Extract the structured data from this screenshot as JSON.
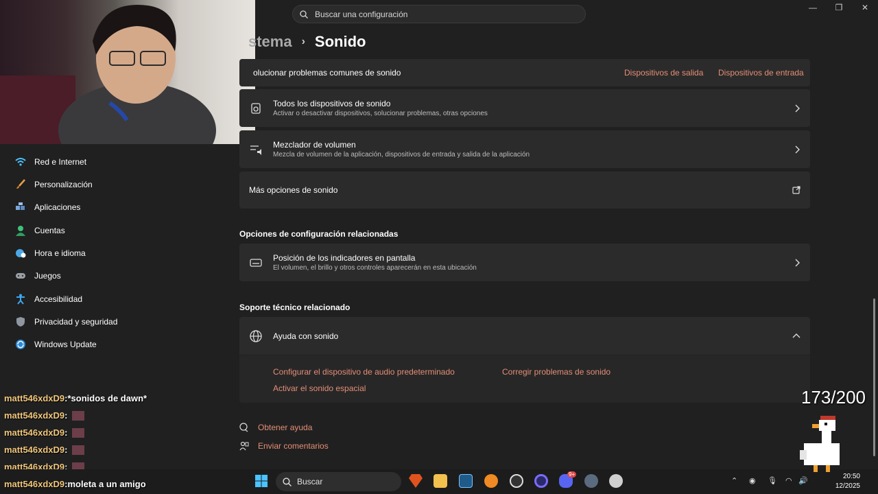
{
  "window": {
    "search_placeholder": "Buscar una configuración",
    "controls": [
      "minimize-icon",
      "restore-icon",
      "close-icon"
    ]
  },
  "breadcrumb": {
    "parent": "stema",
    "current": "Sonido"
  },
  "troubleshoot": {
    "label": "olucionar problemas comunes de sonido",
    "link_output": "Dispositivos de salida",
    "link_input": "Dispositivos de entrada"
  },
  "cards": {
    "all_devices": {
      "title": "Todos los dispositivos de sonido",
      "desc": "Activar o desactivar dispositivos, solucionar problemas, otras opciones"
    },
    "mixer": {
      "title": "Mezclador de volumen",
      "desc": "Mezcla de volumen de la aplicación, dispositivos de entrada y salida de la aplicación"
    },
    "more": {
      "title": "Más opciones de sonido"
    }
  },
  "related_settings": {
    "heading": "Opciones de configuración relacionadas",
    "indicator": {
      "title": "Posición de los indicadores en pantalla",
      "desc": "El volumen, el brillo y otros controles aparecerán en esta ubicación"
    }
  },
  "support": {
    "heading": "Soporte técnico relacionado",
    "help_title": "Ayuda con sonido",
    "links": {
      "default_device": "Configurar el dispositivo de audio predeterminado",
      "fix": "Corregir problemas de sonido",
      "spatial": "Activar el sonido espacial"
    }
  },
  "footer": {
    "get_help": "Obtener ayuda",
    "feedback": "Enviar comentarios"
  },
  "sidebar": {
    "items": [
      {
        "label": "Red e Internet",
        "icon": "wifi-icon",
        "color": "#4cc2ff"
      },
      {
        "label": "Personalización",
        "icon": "brush-icon",
        "color": "#e8a04a"
      },
      {
        "label": "Aplicaciones",
        "icon": "apps-icon",
        "color": "#7aa7d9"
      },
      {
        "label": "Cuentas",
        "icon": "person-icon",
        "color": "#3fc27a"
      },
      {
        "label": "Hora e idioma",
        "icon": "globe-clock-icon",
        "color": "#4aa8e8"
      },
      {
        "label": "Juegos",
        "icon": "gamepad-icon",
        "color": "#9aa0a6"
      },
      {
        "label": "Accesibilidad",
        "icon": "accessibility-icon",
        "color": "#3ea6f0"
      },
      {
        "label": "Privacidad y seguridad",
        "icon": "shield-icon",
        "color": "#8f96a0"
      },
      {
        "label": "Windows Update",
        "icon": "update-icon",
        "color": "#2d8ad6"
      }
    ]
  },
  "chat": {
    "messages": [
      {
        "user": "matt546xdxD9",
        "sep": " : ",
        "text": "*sonidos de dawn*"
      },
      {
        "user": "matt546xdxD9",
        "sep": " : ",
        "text": ""
      },
      {
        "user": "matt546xdxD9",
        "sep": " : ",
        "text": ""
      },
      {
        "user": "matt546xdxD9",
        "sep": " : ",
        "text": ""
      },
      {
        "user": "matt546xdxD9",
        "sep": " : ",
        "text": ""
      },
      {
        "user": "matt546xdxD9",
        "sep": " : ",
        "text": "moleta a un amigo"
      }
    ]
  },
  "counter": "173/200",
  "taskbar": {
    "search": "Buscar",
    "time": "20:50",
    "date": "12/2025",
    "badge": "9+"
  },
  "colors": {
    "accent": "#e58e77",
    "card": "#2b2b2b",
    "bg": "#202020"
  }
}
